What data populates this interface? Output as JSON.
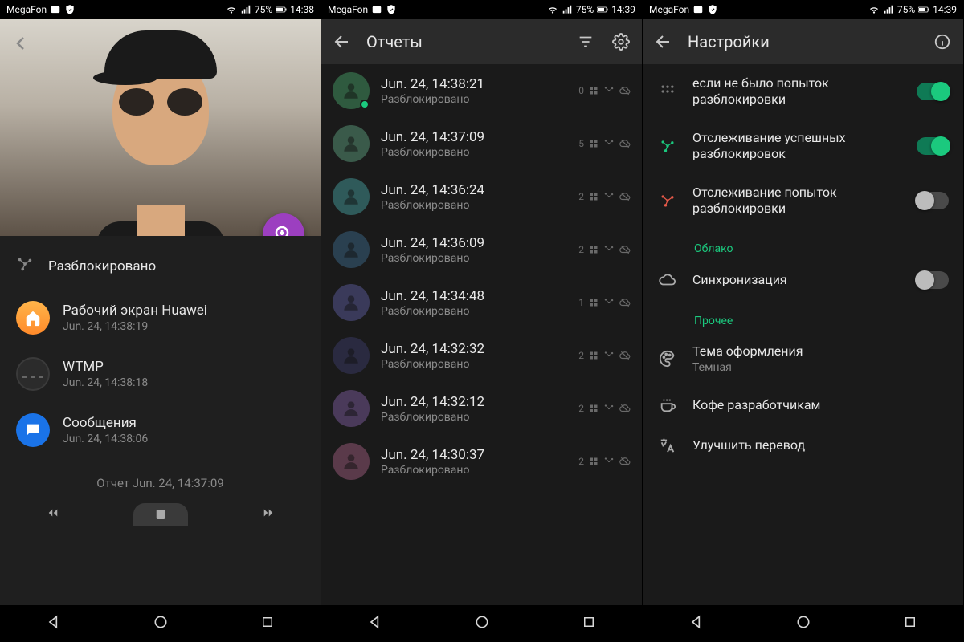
{
  "status": {
    "carrier": "MegaFon",
    "battery_pct": "75%",
    "time_s1": "14:38",
    "time_s2": "14:39",
    "time_s3": "14:39"
  },
  "screen1": {
    "unlocked_label": "Разблокировано",
    "apps": [
      {
        "name": "Рабочий экран Huawei",
        "time": "Jun. 24, 14:38:19",
        "color": "orange",
        "icon": "home"
      },
      {
        "name": "WTMP",
        "time": "Jun. 24, 14:38:18",
        "color": "dark",
        "icon": "wtmp"
      },
      {
        "name": "Сообщения",
        "time": "Jun. 24, 14:38:06",
        "color": "blue",
        "icon": "msg"
      }
    ],
    "footer": "Отчет  Jun. 24, 14:37:09"
  },
  "screen2": {
    "title": "Отчеты",
    "unlocked_label": "Разблокировано",
    "reports": [
      {
        "time": "Jun. 24, 14:38:21",
        "count": "0",
        "avatarColor": "#2f5a3f",
        "online": true
      },
      {
        "time": "Jun. 24, 14:37:09",
        "count": "5",
        "avatarColor": "#3a5a4a",
        "online": false
      },
      {
        "time": "Jun. 24, 14:36:24",
        "count": "2",
        "avatarColor": "#2f5a5a",
        "online": false
      },
      {
        "time": "Jun. 24, 14:36:09",
        "count": "2",
        "avatarColor": "#2a4050",
        "online": false
      },
      {
        "time": "Jun. 24, 14:34:48",
        "count": "1",
        "avatarColor": "#3a3a5a",
        "online": false
      },
      {
        "time": "Jun. 24, 14:32:32",
        "count": "2",
        "avatarColor": "#2a2a40",
        "online": false
      },
      {
        "time": "Jun. 24, 14:32:12",
        "count": "2",
        "avatarColor": "#4a3a5a",
        "online": false
      },
      {
        "time": "Jun. 24, 14:30:37",
        "count": "2",
        "avatarColor": "#5a3a4a",
        "online": false
      }
    ]
  },
  "screen3": {
    "title": "Настройки",
    "row0": {
      "text": "если не было попыток разблокировки",
      "on": true
    },
    "row1": {
      "text": "Отслеживание успешных разблокировок",
      "on": true
    },
    "row2": {
      "text": "Отслеживание попыток разблокировки",
      "on": false
    },
    "section_cloud": "Облако",
    "row_sync": {
      "text": "Синхронизация",
      "on": false
    },
    "section_other": "Прочее",
    "row_theme": {
      "text": "Тема оформления",
      "sub": "Темная"
    },
    "row_coffee": {
      "text": "Кофе разработчикам"
    },
    "row_translate": {
      "text": "Улучшить перевод"
    }
  }
}
